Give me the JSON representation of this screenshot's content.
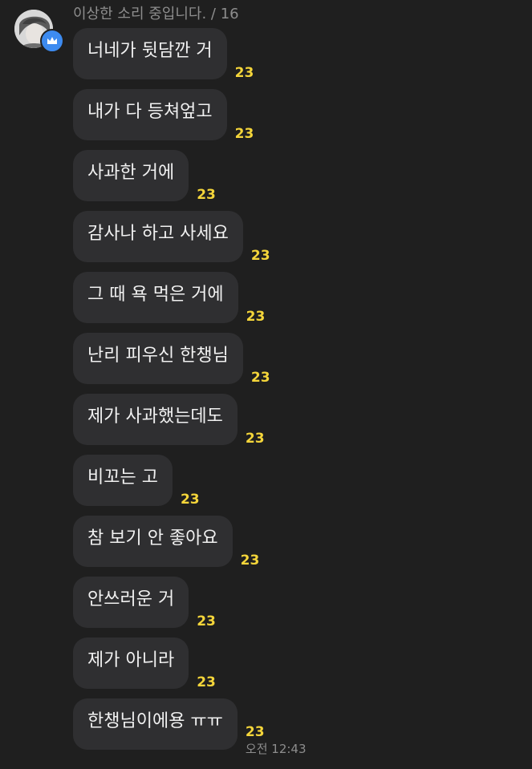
{
  "sender": {
    "name_line": "이상한 소리 중입니다. / 16"
  },
  "messages": [
    {
      "text": "너네가 뒷담깐 거",
      "unread": "23"
    },
    {
      "text": "내가 다 등쳐엎고",
      "unread": "23"
    },
    {
      "text": "사과한 거에",
      "unread": "23"
    },
    {
      "text": "감사나 하고 사세요",
      "unread": "23"
    },
    {
      "text": "그 때 욕 먹은 거에",
      "unread": "23"
    },
    {
      "text": "난리 피우신 한챙님",
      "unread": "23"
    },
    {
      "text": "제가 사과했는데도",
      "unread": "23"
    },
    {
      "text": "비꼬는 고",
      "unread": "23"
    },
    {
      "text": "참 보기 안 좋아요",
      "unread": "23"
    },
    {
      "text": "안쓰러운 거",
      "unread": "23"
    },
    {
      "text": "제가 아니라",
      "unread": "23"
    },
    {
      "text": "한챙님이에용 ㅠㅠ",
      "unread": "23",
      "time": "오전 12:43"
    }
  ],
  "colors": {
    "background": "#1f1f1f",
    "bubble": "#2f2f31",
    "unread": "#f4d53a",
    "badge": "#3d8bf0"
  },
  "icons": {
    "avatar": "profile-photo",
    "badge": "crown-icon"
  }
}
